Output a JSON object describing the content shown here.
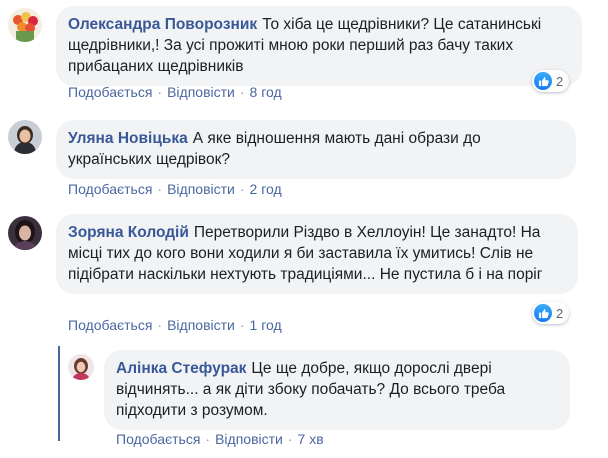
{
  "actions": {
    "like": "Подобається",
    "reply": "Відповісти",
    "sep": "·"
  },
  "comments": [
    {
      "author": "Олександра Поворозник",
      "text": "То хіба це щедрівники? Це сатанинські щедрівники,! За усі прожиті мною роки перший раз бачу таких прибацаних щедрівників",
      "time": "8 год",
      "likes": "2"
    },
    {
      "author": "Уляна Новіцька",
      "text": "А яке відношення мають дані образи до українських щедрівок?",
      "time": "2 год"
    },
    {
      "author": "Зоряна Колодій",
      "text": "Перетворили Різдво в Хеллоуін! Це занадто! На місці тих до кого вони ходили я би заставила їх умитись! Слів не підібрати наскільки нехтують традиціями... Не пустила б і на поріг",
      "time": "1 год",
      "likes": "2"
    },
    {
      "author": "Алінка Стефурак",
      "text": "Це ще добре, якщо дорослі двері відчинять... а як діти збоку побачать? До всього треба підходити з розумом.",
      "time": "7 хв"
    }
  ],
  "colors": {
    "author": "#385898",
    "link": "#4b67a1",
    "bubble": "#f2f3f5",
    "like": "#1877f2"
  }
}
